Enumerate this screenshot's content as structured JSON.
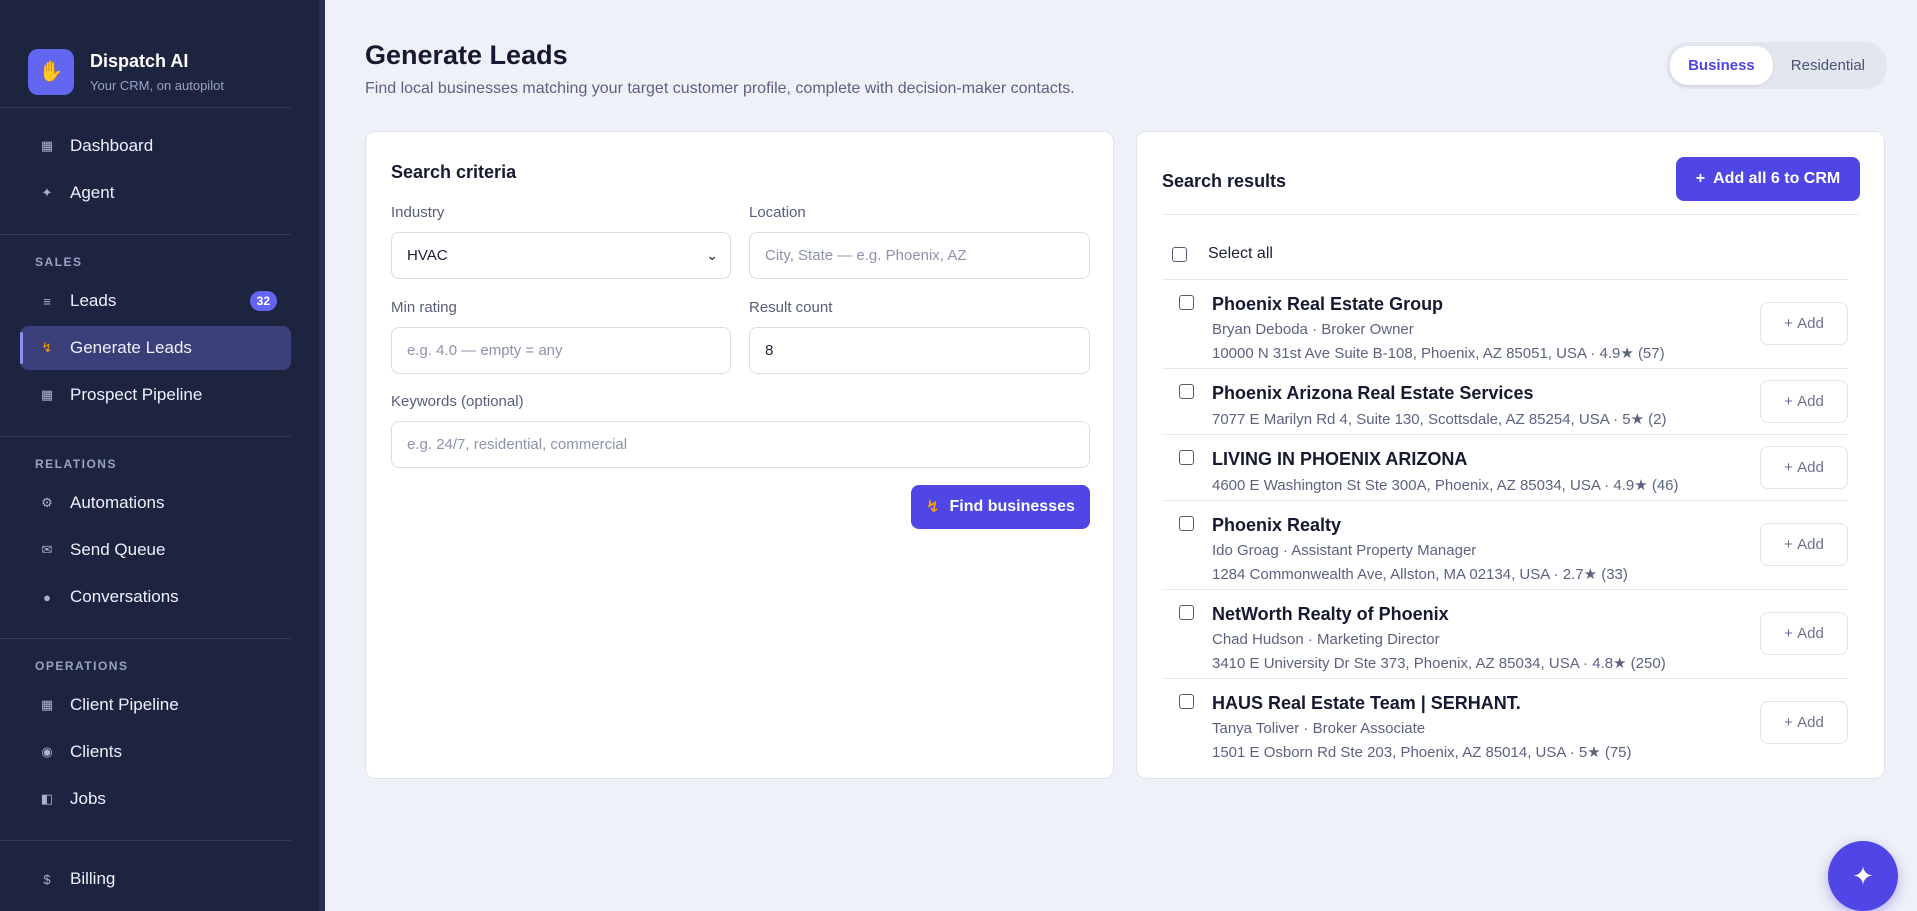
{
  "brand": {
    "name": "Dispatch AI",
    "tagline": "Your CRM, on autopilot",
    "logo_icon": "robot-icon"
  },
  "nav": {
    "top": [
      {
        "label": "Dashboard",
        "icon": "grid-icon"
      },
      {
        "label": "Agent",
        "icon": "sparkle-icon"
      }
    ],
    "sales": {
      "heading": "SALES",
      "items": [
        {
          "label": "Leads",
          "icon": "list-icon",
          "badge": "32"
        },
        {
          "label": "Generate Leads",
          "icon": "bolt-icon",
          "active": true
        },
        {
          "label": "Prospect Pipeline",
          "icon": "grid-icon"
        }
      ]
    },
    "relations": {
      "heading": "RELATIONS",
      "items": [
        {
          "label": "Automations",
          "icon": "gear-icon"
        },
        {
          "label": "Send Queue",
          "icon": "mail-icon"
        },
        {
          "label": "Conversations",
          "icon": "chat-icon"
        }
      ]
    },
    "operations": {
      "heading": "OPERATIONS",
      "items": [
        {
          "label": "Client Pipeline",
          "icon": "grid-icon"
        },
        {
          "label": "Clients",
          "icon": "circle-icon"
        },
        {
          "label": "Jobs",
          "icon": "book-icon"
        }
      ]
    },
    "bottom": [
      {
        "label": "Billing",
        "icon": "dollar-icon"
      }
    ]
  },
  "header": {
    "title": "Generate Leads",
    "subtitle": "Find local businesses matching your target customer profile, complete with decision-maker contacts.",
    "toggle": {
      "business": "Business",
      "residential": "Residential",
      "selected": "Business"
    }
  },
  "criteria": {
    "title": "Search criteria",
    "industry": {
      "label": "Industry",
      "value": "HVAC"
    },
    "location": {
      "label": "Location",
      "placeholder": "City, State — e.g. Phoenix, AZ"
    },
    "min_rating": {
      "label": "Min rating",
      "placeholder": "e.g. 4.0 — empty = any"
    },
    "result_count": {
      "label": "Result count",
      "value": "8"
    },
    "keywords": {
      "label": "Keywords (optional)",
      "placeholder": "e.g. 24/7, residential, commercial"
    },
    "find_button": "Find businesses"
  },
  "results": {
    "title": "Search results",
    "add_all_button": "Add all 6 to CRM",
    "select_all": "Select all",
    "add_label": "Add",
    "items": [
      {
        "name": "Phoenix Real Estate Group",
        "contact": "Bryan Deboda · Broker Owner",
        "address": "10000 N 31st Ave Suite B-108, Phoenix, AZ 85051, USA · 4.9★ (57)"
      },
      {
        "name": "Phoenix Arizona Real Estate Services",
        "contact": "",
        "address": "7077 E Marilyn Rd 4, Suite 130, Scottsdale, AZ 85254, USA · 5★ (2)"
      },
      {
        "name": "LIVING IN PHOENIX ARIZONA",
        "contact": "",
        "address": "4600 E Washington St Ste 300A, Phoenix, AZ 85034, USA · 4.9★ (46)"
      },
      {
        "name": "Phoenix Realty",
        "contact": "Ido Groag · Assistant Property Manager",
        "address": "1284 Commonwealth Ave, Allston, MA 02134, USA · 2.7★ (33)"
      },
      {
        "name": "NetWorth Realty of Phoenix",
        "contact": "Chad Hudson · Marketing Director",
        "address": "3410 E University Dr Ste 373, Phoenix, AZ 85034, USA · 4.8★ (250)"
      },
      {
        "name": "HAUS Real Estate Team | SERHANT.",
        "contact": "Tanya Toliver · Broker Associate",
        "address": "1501 E Osborn Rd Ste 203, Phoenix, AZ 85014, USA · 5★ (75)"
      }
    ]
  },
  "fab_icon": "sparkle-icon",
  "colors": {
    "accent": "#4f46e5",
    "sidebar": "#1d2440",
    "bolt": "#f59e0b"
  }
}
